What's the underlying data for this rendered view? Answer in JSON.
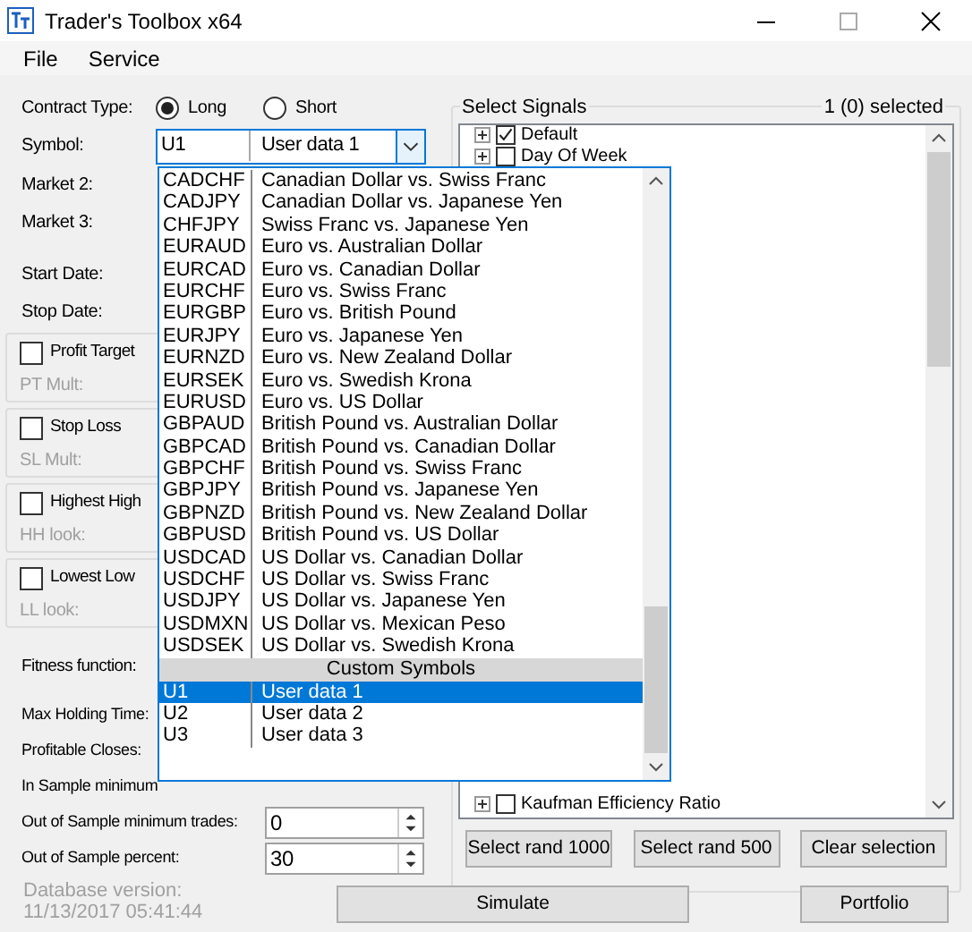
{
  "window": {
    "title": "Trader's Toolbox x64"
  },
  "menu": [
    "File",
    "Service"
  ],
  "contract_type": {
    "label": "Contract Type:",
    "options": [
      {
        "label": "Long",
        "selected": true
      },
      {
        "label": "Short",
        "selected": false
      }
    ]
  },
  "symbol": {
    "label": "Symbol:",
    "code": "U1",
    "name": "User data 1",
    "dropdown": {
      "items": [
        {
          "kind": "item",
          "code": "CADCHF",
          "name": "Canadian Dollar vs. Swiss Franc",
          "selected": false
        },
        {
          "kind": "item",
          "code": "CADJPY",
          "name": "Canadian Dollar vs. Japanese Yen",
          "selected": false
        },
        {
          "kind": "item",
          "code": "CHFJPY",
          "name": "Swiss Franc vs. Japanese Yen",
          "selected": false
        },
        {
          "kind": "item",
          "code": "EURAUD",
          "name": "Euro vs. Australian Dollar",
          "selected": false
        },
        {
          "kind": "item",
          "code": "EURCAD",
          "name": "Euro vs. Canadian Dollar",
          "selected": false
        },
        {
          "kind": "item",
          "code": "EURCHF",
          "name": "Euro vs. Swiss Franc",
          "selected": false
        },
        {
          "kind": "item",
          "code": "EURGBP",
          "name": "Euro vs. British Pound",
          "selected": false
        },
        {
          "kind": "item",
          "code": "EURJPY",
          "name": "Euro vs. Japanese Yen",
          "selected": false
        },
        {
          "kind": "item",
          "code": "EURNZD",
          "name": "Euro vs. New Zealand Dollar",
          "selected": false
        },
        {
          "kind": "item",
          "code": "EURSEK",
          "name": "Euro vs. Swedish Krona",
          "selected": false
        },
        {
          "kind": "item",
          "code": "EURUSD",
          "name": "Euro vs. US Dollar",
          "selected": false
        },
        {
          "kind": "item",
          "code": "GBPAUD",
          "name": "British Pound vs. Australian Dollar",
          "selected": false
        },
        {
          "kind": "item",
          "code": "GBPCAD",
          "name": "British Pound vs. Canadian Dollar",
          "selected": false
        },
        {
          "kind": "item",
          "code": "GBPCHF",
          "name": "British Pound vs. Swiss Franc",
          "selected": false
        },
        {
          "kind": "item",
          "code": "GBPJPY",
          "name": "British Pound vs. Japanese Yen",
          "selected": false
        },
        {
          "kind": "item",
          "code": "GBPNZD",
          "name": "British Pound vs. New Zealand Dollar",
          "selected": false
        },
        {
          "kind": "item",
          "code": "GBPUSD",
          "name": "British Pound vs. US Dollar",
          "selected": false
        },
        {
          "kind": "item",
          "code": "USDCAD",
          "name": "US Dollar vs. Canadian Dollar",
          "selected": false
        },
        {
          "kind": "item",
          "code": "USDCHF",
          "name": "US Dollar vs. Swiss Franc",
          "selected": false
        },
        {
          "kind": "item",
          "code": "USDJPY",
          "name": "US Dollar vs. Japanese Yen",
          "selected": false
        },
        {
          "kind": "item",
          "code": "USDMXN",
          "name": "US Dollar vs. Mexican Peso",
          "selected": false
        },
        {
          "kind": "item",
          "code": "USDSEK",
          "name": "US Dollar vs. Swedish Krona",
          "selected": false
        },
        {
          "kind": "header",
          "label": "Custom Symbols"
        },
        {
          "kind": "item",
          "code": "U1",
          "name": "User data 1",
          "selected": true
        },
        {
          "kind": "item",
          "code": "U2",
          "name": "User data 2",
          "selected": false
        },
        {
          "kind": "item",
          "code": "U3",
          "name": "User data 3",
          "selected": false
        }
      ]
    }
  },
  "fields": [
    "Market 2:",
    "Market 3:",
    "Start Date:",
    "Stop Date:"
  ],
  "exit_groups": [
    {
      "label": "Profit Target",
      "checked": false,
      "param": "PT Mult:"
    },
    {
      "label": "Stop Loss",
      "checked": false,
      "param": "SL Mult:"
    },
    {
      "label": "Highest High",
      "checked": false,
      "param": "HH look:"
    },
    {
      "label": "Lowest Low",
      "checked": false,
      "param": "LL look:"
    }
  ],
  "fitness_label": "Fitness function:",
  "params": [
    {
      "label": "Max Holding Time:"
    },
    {
      "label": "Profitable Closes:"
    },
    {
      "label": "In Sample minimum"
    },
    {
      "label": "Out of Sample minimum trades:",
      "value": "0"
    },
    {
      "label": "Out of Sample percent:",
      "value": "30"
    }
  ],
  "signals": {
    "title": "Select Signals",
    "count": "1 (0) selected",
    "items": [
      {
        "label": "Default",
        "checked": true
      },
      {
        "label": "Day Of Week",
        "checked": false
      },
      {
        "label": "Kaufman Efficiency Ratio",
        "checked": false
      }
    ],
    "buttons": [
      "Select rand 1000",
      "Select rand 500",
      "Clear selection"
    ]
  },
  "footer": {
    "database_label": "Database version:",
    "database_date": "11/13/2017 05:41:44",
    "buttons": [
      "Simulate",
      "Portfolio"
    ]
  }
}
